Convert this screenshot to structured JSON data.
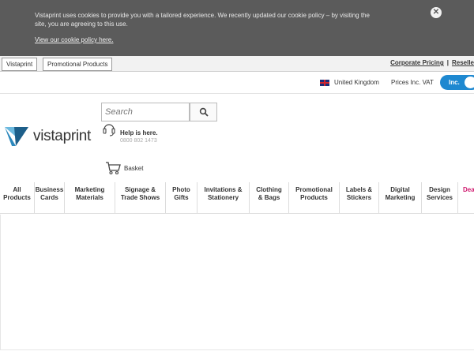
{
  "cookie": {
    "message": "Vistaprint uses cookies to provide you with a tailored experience. We recently updated our cookie policy – by visiting the site, you are agreeing to this use.",
    "link": "View our cookie policy here.",
    "close_symbol": "✕"
  },
  "topbar": {
    "tabs": [
      "Vistaprint",
      "Promotional Products"
    ],
    "links": [
      "Corporate Pricing",
      "Reselle"
    ],
    "separator": "|"
  },
  "locale": {
    "country": "United Kingdom",
    "prices_label": "Prices Inc. VAT",
    "toggle_label": "Inc."
  },
  "header": {
    "logo_text": "vistaprint",
    "search_placeholder": "Search",
    "help_title": "Help is here.",
    "help_phone": "0800 802 1473",
    "basket_label": "Basket"
  },
  "nav": {
    "items": [
      [
        "All",
        "Products"
      ],
      [
        "Business",
        "Cards"
      ],
      [
        "Marketing",
        "Materials"
      ],
      [
        "Signage &",
        "Trade Shows"
      ],
      [
        "Photo",
        "Gifts"
      ],
      [
        "Invitations &",
        "Stationery"
      ],
      [
        "Clothing",
        "& Bags"
      ],
      [
        "Promotional",
        "Products"
      ],
      [
        "Labels &",
        "Stickers"
      ],
      [
        "Digital",
        "Marketing"
      ],
      [
        "Design",
        "Services"
      ],
      [
        "Dea",
        ""
      ]
    ]
  },
  "colors": {
    "cookie_bg": "#5b5b5b",
    "accent_blue": "#1e88d0",
    "logo_blue": "#1d5f8a",
    "deals_pink": "#d0196f"
  }
}
